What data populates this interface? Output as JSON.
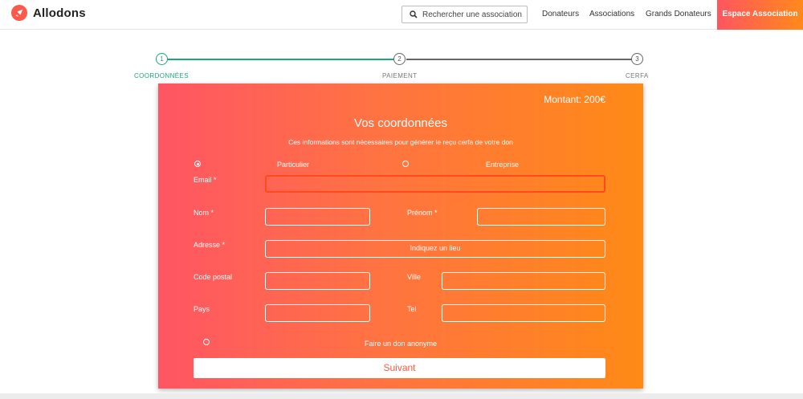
{
  "header": {
    "logo_text": "Allodons",
    "search_placeholder": "Rechercher une association",
    "nav": [
      "Donateurs",
      "Associations",
      "Grands Donateurs"
    ],
    "cta": "Espace Association"
  },
  "stepper": {
    "steps": [
      {
        "number": "1",
        "label": "COORDONNÉES"
      },
      {
        "number": "2",
        "label": "PAIEMENT"
      },
      {
        "number": "3",
        "label": "CERFA"
      }
    ]
  },
  "form": {
    "amount": "Montant: 200€",
    "title": "Vos coordonnées",
    "subtitle": "Ces informations sont nécessaires pour générer le reçu cerfa de votre don",
    "type_options": [
      "Particulier",
      "Entreprise"
    ],
    "labels": {
      "email": "Email *",
      "nom": "Nom *",
      "prenom": "Prénom *",
      "adresse": "Adresse *",
      "code_postal": "Code postal",
      "ville": "Ville",
      "pays": "Pays",
      "tel": "Tel"
    },
    "adresse_placeholder": "Indiquez un lieu",
    "anonymous_label": "Faire un don anonyme",
    "submit_label": "Suivant"
  },
  "colors": {
    "accent_green": "#1aaa74",
    "gradient_start": "#ff5564",
    "gradient_end": "#ff8a16"
  }
}
